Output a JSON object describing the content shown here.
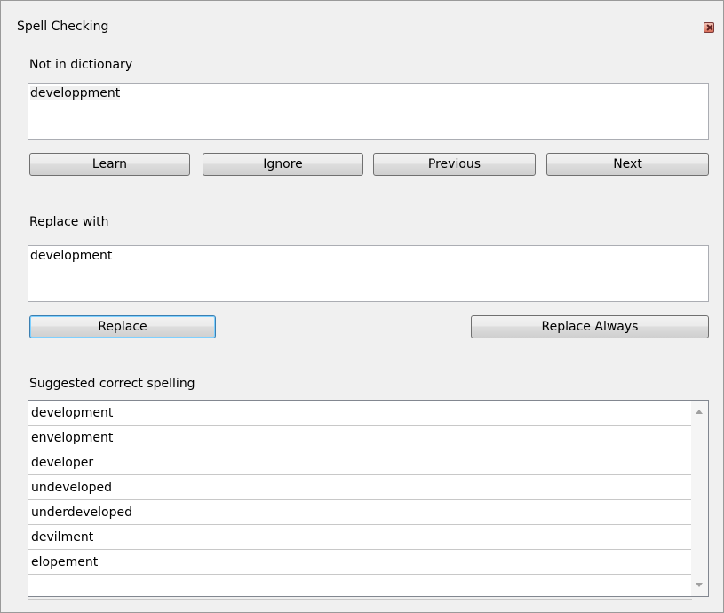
{
  "window": {
    "title": "Spell Checking",
    "close_icon": "close-icon"
  },
  "not_in_dictionary": {
    "label": "Not in dictionary",
    "value": "developpment"
  },
  "actions": {
    "learn": "Learn",
    "ignore": "Ignore",
    "previous": "Previous",
    "next": "Next"
  },
  "replace_with": {
    "label": "Replace with",
    "value": "development"
  },
  "replace_actions": {
    "replace": "Replace",
    "replace_always": "Replace Always"
  },
  "suggestions": {
    "label": "Suggested correct spelling",
    "items": [
      "development",
      "envelopment",
      "developer",
      "undeveloped",
      "underdeveloped",
      "devilment",
      "elopement",
      ""
    ]
  }
}
